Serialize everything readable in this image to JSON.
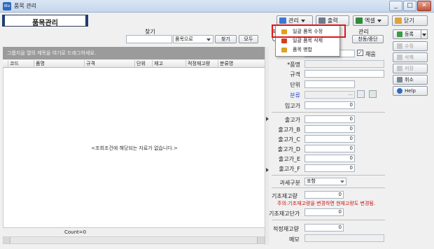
{
  "window": {
    "title": "품목 관리",
    "app_icon": "app-icon",
    "controls": [
      "_",
      "□",
      "✕"
    ]
  },
  "header": {
    "title": "품목관리"
  },
  "toolbar": {
    "manage_label": "관리",
    "print_label": "출력",
    "excel_label": "엑셀",
    "close_label": "닫기",
    "manage_icon_color": "#3a78d8",
    "print_icon_color": "#6c7c8c",
    "excel_icon_color": "#2f8a3a",
    "close_icon_color": "#e2a23a"
  },
  "manage_menu": {
    "items": [
      {
        "label": "일괄 품목 수정",
        "icon": "edit-icon",
        "color": "#e0a020"
      },
      {
        "label": "일괄 품목 삭제",
        "icon": "delete-icon",
        "color": "#d04020"
      },
      {
        "label": "품목 병합",
        "icon": "merge-icon",
        "color": "#e0a020"
      }
    ]
  },
  "search": {
    "label": "찾기",
    "value": "",
    "scope": "품목으로",
    "find_label": "찾기",
    "all_label": "모두"
  },
  "grid": {
    "group_hint": "그룹지을 열의 제목을 여기로 드래그하세요.",
    "columns": [
      "코드",
      "품명",
      "규격",
      "단위",
      "재고",
      "적정재고량",
      "분류명"
    ],
    "empty_message": "<조회조건에 해당되는 자료가 없습니다.>",
    "count_label": "Count=0"
  },
  "side_panel": {
    "partial_label": "관리",
    "disable_label": "찬동/중단",
    "use_checkbox_label": "채움",
    "use_checked": true
  },
  "form": {
    "name_label": "*품명",
    "spec_label": "규격",
    "unit_label": "단위",
    "category_label": "분류",
    "in_price_label": "입고가",
    "in_price": "0",
    "out_price_label": "출고가",
    "out_price": "0",
    "out_b_label": "출고가_B",
    "out_b": "0",
    "out_c_label": "출고가_C",
    "out_c": "0",
    "out_d_label": "출고가_D",
    "out_d": "0",
    "out_e_label": "출고가_E",
    "out_e": "0",
    "out_f_label": "출고가_F",
    "out_f": "0",
    "tax_label": "과세구분",
    "tax_value": "포함",
    "base_stock_label": "기초재고량",
    "base_stock": "0",
    "warning": "주의:기초재고량을 변경하면 현재고량도 변경됨.",
    "base_cost_label": "기초재고단가",
    "base_cost": "0",
    "proper_stock_label": "적정재고량",
    "proper_stock": "0",
    "memo_label": "메모",
    "category_accent": "#1f3fd0",
    "warning_color": "#d01010"
  },
  "actions": {
    "add_label": "등록",
    "edit_label": "수정",
    "delete_label": "삭제",
    "save_label": "저장",
    "cancel_label": "취소",
    "help_label": "Help"
  }
}
